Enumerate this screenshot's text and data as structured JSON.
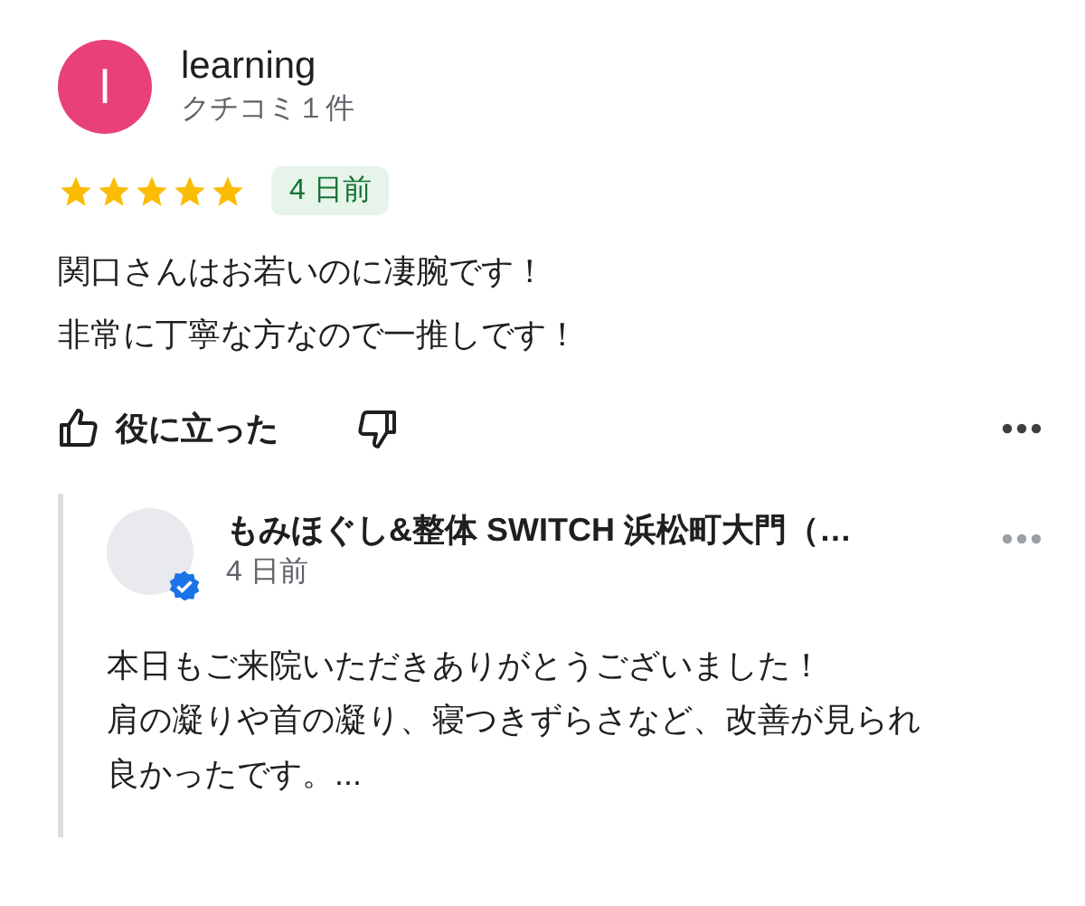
{
  "reviewer": {
    "initial": "l",
    "name": "learning",
    "review_count": "クチコミ１件"
  },
  "rating": {
    "stars": 5
  },
  "date_badge": "4 日前",
  "review_lines": [
    "関口さんはお若いのに凄腕です！",
    "非常に丁寧な方なので一推しです！"
  ],
  "actions": {
    "helpful": "役に立った"
  },
  "owner_reply": {
    "name": "もみほぐし&整体 SWITCH 浜松町大門（…",
    "verified": true,
    "date": "4 日前",
    "lines": [
      "本日もご来院いただきありがとうございました！",
      "肩の凝りや首の凝り、寝つきずらさなど、改善が見られ",
      "良かったです。..."
    ]
  }
}
